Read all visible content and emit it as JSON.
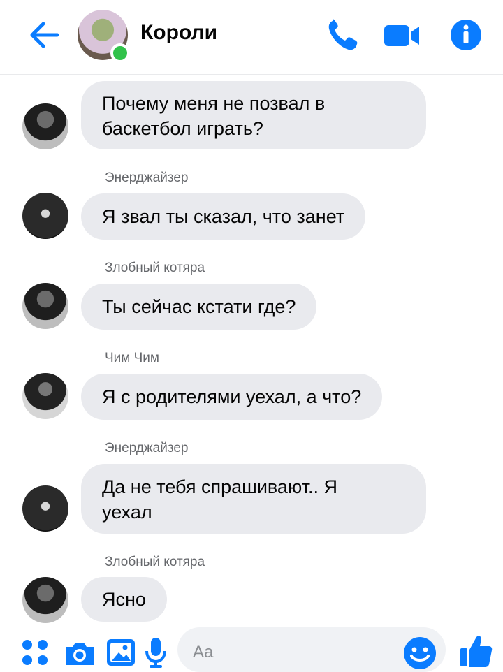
{
  "header": {
    "title": "Короли",
    "back_icon": "arrow-left-icon",
    "call_icon": "phone-icon",
    "video_icon": "video-camera-icon",
    "info_icon": "info-icon",
    "accent_color": "#0a7cff",
    "online_color": "#31c24a"
  },
  "messages": [
    {
      "sender": "",
      "text": "Почему меня не позвал в\nбаскетбол играть?"
    },
    {
      "sender": "Энерджайзер",
      "text": "Я звал ты сказал, что занет"
    },
    {
      "sender": "Злобный котяра",
      "text": "Ты сейчас кстати где?"
    },
    {
      "sender": "Чим Чим",
      "text": "Я с родителями уехал, а что?"
    },
    {
      "sender": "Энерджайзер",
      "text": "Да не тебя спрашивают.. Я\nуехал"
    },
    {
      "sender": "Злобный котяра",
      "text": "Ясно"
    }
  ],
  "composer": {
    "placeholder": "Aa",
    "menu_icon": "four-dots-icon",
    "camera_icon": "camera-icon",
    "gallery_icon": "image-icon",
    "mic_icon": "microphone-icon",
    "emoji_icon": "smile-icon",
    "like_icon": "thumbs-up-icon"
  }
}
